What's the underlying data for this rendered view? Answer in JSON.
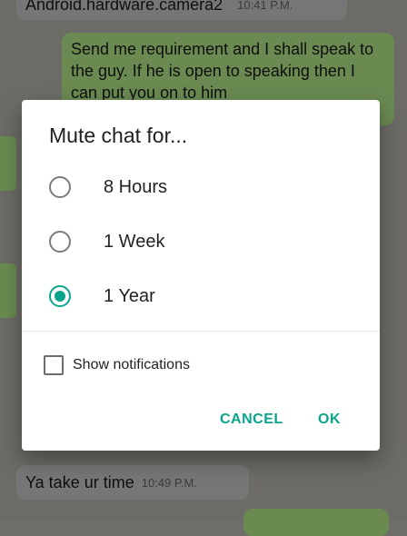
{
  "background_chat": {
    "message_top_text": "Android.hardware.camera2",
    "message_top_time": "10:41 P.M.",
    "message_out_text": "Send me requirement and I shall speak to the guy.  If he is open to speaking then I can put you on to him",
    "message_bottom_text": "Ya take ur time",
    "message_bottom_time": "10:49 P.M."
  },
  "dialog": {
    "title": "Mute chat for...",
    "options": [
      {
        "label": "8 Hours",
        "selected": false
      },
      {
        "label": "1 Week",
        "selected": false
      },
      {
        "label": "1 Year",
        "selected": true
      }
    ],
    "checkbox_label": "Show notifications",
    "checkbox_checked": false,
    "cancel_label": "CANCEL",
    "ok_label": "OK"
  },
  "colors": {
    "accent": "#09a58b",
    "background_overlay": "#6c6b66",
    "dialog_bg": "#ffffff"
  }
}
